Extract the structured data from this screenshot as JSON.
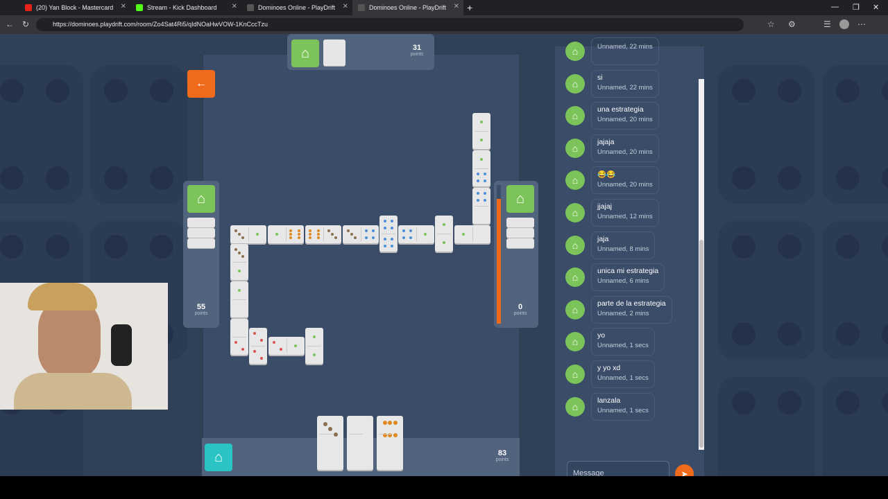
{
  "browser": {
    "tabs": [
      {
        "title": "(20) Yan Block - Mastercard"
      },
      {
        "title": "Stream - Kick Dashboard"
      },
      {
        "title": "Dominoes Online - PlayDrift"
      },
      {
        "title": "Dominoes Online - PlayDrift"
      }
    ],
    "url": "https://dominoes.playdrift.com/room/Zo4Sat4Ri5/qIdNOaHwVOW-1KnCccTzu"
  },
  "colors": {
    "accent": "#f06a1b",
    "player_green": "#7cc45a",
    "player_teal": "#2bc4c4",
    "board": "#3a4c68"
  },
  "players": {
    "top": {
      "points": "31",
      "label": "points",
      "avatar_icon": "robot-icon"
    },
    "left": {
      "points": "55",
      "label": "points",
      "avatar_icon": "robot-icon"
    },
    "right": {
      "points": "0",
      "label": "points",
      "avatar_icon": "robot-icon"
    },
    "bottom": {
      "points": "83",
      "label": "points",
      "avatar_icon": "robot-icon"
    }
  },
  "right_timer_progress": 0.9,
  "chat": {
    "messages": [
      {
        "text": "",
        "meta": "Unnamed, 22 mins"
      },
      {
        "text": "si",
        "meta": "Unnamed, 22 mins"
      },
      {
        "text": "una estrategia",
        "meta": "Unnamed, 20 mins"
      },
      {
        "text": "jajaja",
        "meta": "Unnamed, 20 mins"
      },
      {
        "text": "😂😂",
        "meta": "Unnamed, 20 mins"
      },
      {
        "text": "jjajaj",
        "meta": "Unnamed, 12 mins"
      },
      {
        "text": "jaja",
        "meta": "Unnamed, 8 mins"
      },
      {
        "text": "unica mi estrategia",
        "meta": "Unnamed, 6 mins"
      },
      {
        "text": "parte de la estrategia",
        "meta": "Unnamed, 2 mins"
      },
      {
        "text": "yo",
        "meta": "Unnamed, 1 secs"
      },
      {
        "text": "y yo xd",
        "meta": "Unnamed, 1 secs"
      },
      {
        "text": "lanzala",
        "meta": "Unnamed, 1 secs"
      }
    ],
    "input_placeholder": "Message"
  }
}
